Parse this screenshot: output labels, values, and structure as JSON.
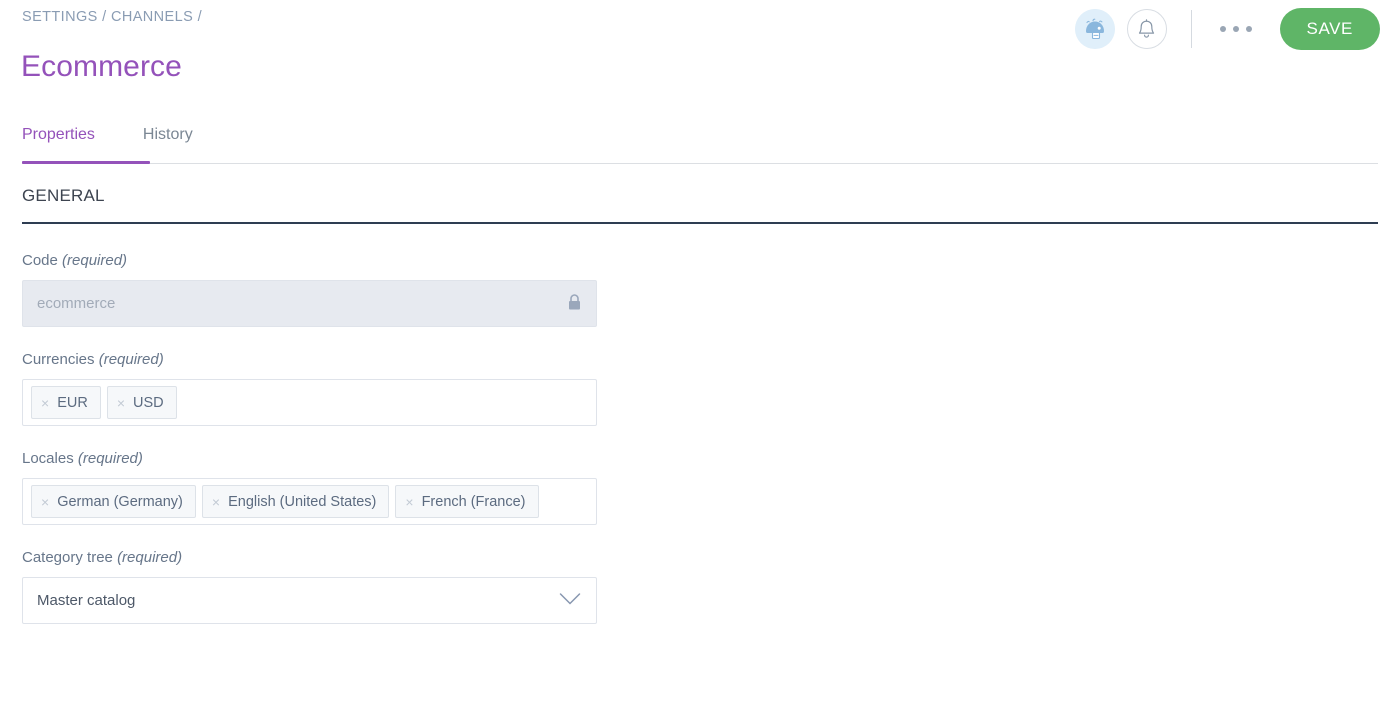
{
  "header": {
    "breadcrumb": "SETTINGS / CHANNELS /",
    "title": "Ecommerce",
    "avatar_icon": "user-avatar-icon",
    "notification_icon": "bell-icon",
    "more_menu_label": "more-options",
    "save_label": "SAVE",
    "accent_purple": "#9452ba",
    "save_green": "#5fb567"
  },
  "tabs": [
    {
      "label": "Properties",
      "active": true
    },
    {
      "label": "History",
      "active": false
    }
  ],
  "section": {
    "title": "GENERAL"
  },
  "fields": {
    "code": {
      "label": "Code",
      "required_text": "(required)",
      "value": "ecommerce",
      "readonly": true,
      "lock_icon": "lock-icon"
    },
    "currencies": {
      "label": "Currencies",
      "required_text": "(required)",
      "tags": [
        "EUR",
        "USD"
      ],
      "remove_glyph": "×"
    },
    "locales": {
      "label": "Locales",
      "required_text": "(required)",
      "tags": [
        "German (Germany)",
        "English (United States)",
        "French (France)"
      ],
      "remove_glyph": "×"
    },
    "category_tree": {
      "label": "Category tree",
      "required_text": "(required)",
      "value": "Master catalog",
      "chevron_icon": "chevron-down-icon"
    }
  }
}
